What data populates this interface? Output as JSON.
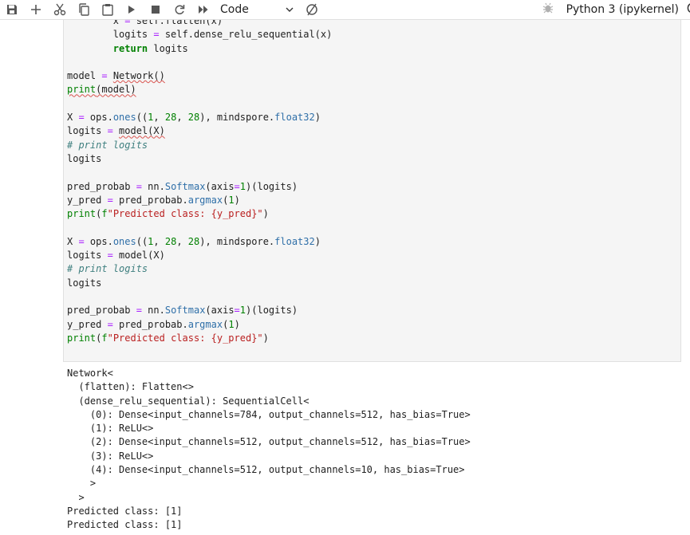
{
  "toolbar": {
    "buttons": [
      "save",
      "add-cell",
      "cut",
      "copy",
      "paste",
      "run",
      "stop",
      "restart",
      "run-all"
    ],
    "cell_type": "Code",
    "kernel_name": "Python 3 (ipykernel)"
  },
  "cell": {
    "lines": [
      "        x = self.flatten(x)",
      "        logits = self.dense_relu_sequential(x)",
      "        return logits",
      "",
      "model = Network()",
      "print(model)",
      "",
      "X = ops.ones((1, 28, 28), mindspore.float32)",
      "logits = model(X)",
      "# print logits",
      "logits",
      "",
      "pred_probab = nn.Softmax(axis=1)(logits)",
      "y_pred = pred_probab.argmax(1)",
      "print(f\"Predicted class: {y_pred}\")",
      "",
      "X = ops.ones((1, 28, 28), mindspore.float32)",
      "logits = model(X)",
      "# print logits",
      "logits",
      "",
      "pred_probab = nn.Softmax(axis=1)(logits)",
      "y_pred = pred_probab.argmax(1)",
      "print(f\"Predicted class: {y_pred}\")"
    ]
  },
  "output": {
    "lines": [
      "Network<",
      "  (flatten): Flatten<>",
      "  (dense_relu_sequential): SequentialCell<",
      "    (0): Dense<input_channels=784, output_channels=512, has_bias=True>",
      "    (1): ReLU<>",
      "    (2): Dense<input_channels=512, output_channels=512, has_bias=True>",
      "    (3): ReLU<>",
      "    (4): Dense<input_channels=512, output_channels=10, has_bias=True>",
      "    >",
      "  >",
      "Predicted class: [1]",
      "Predicted class: [1]"
    ]
  }
}
